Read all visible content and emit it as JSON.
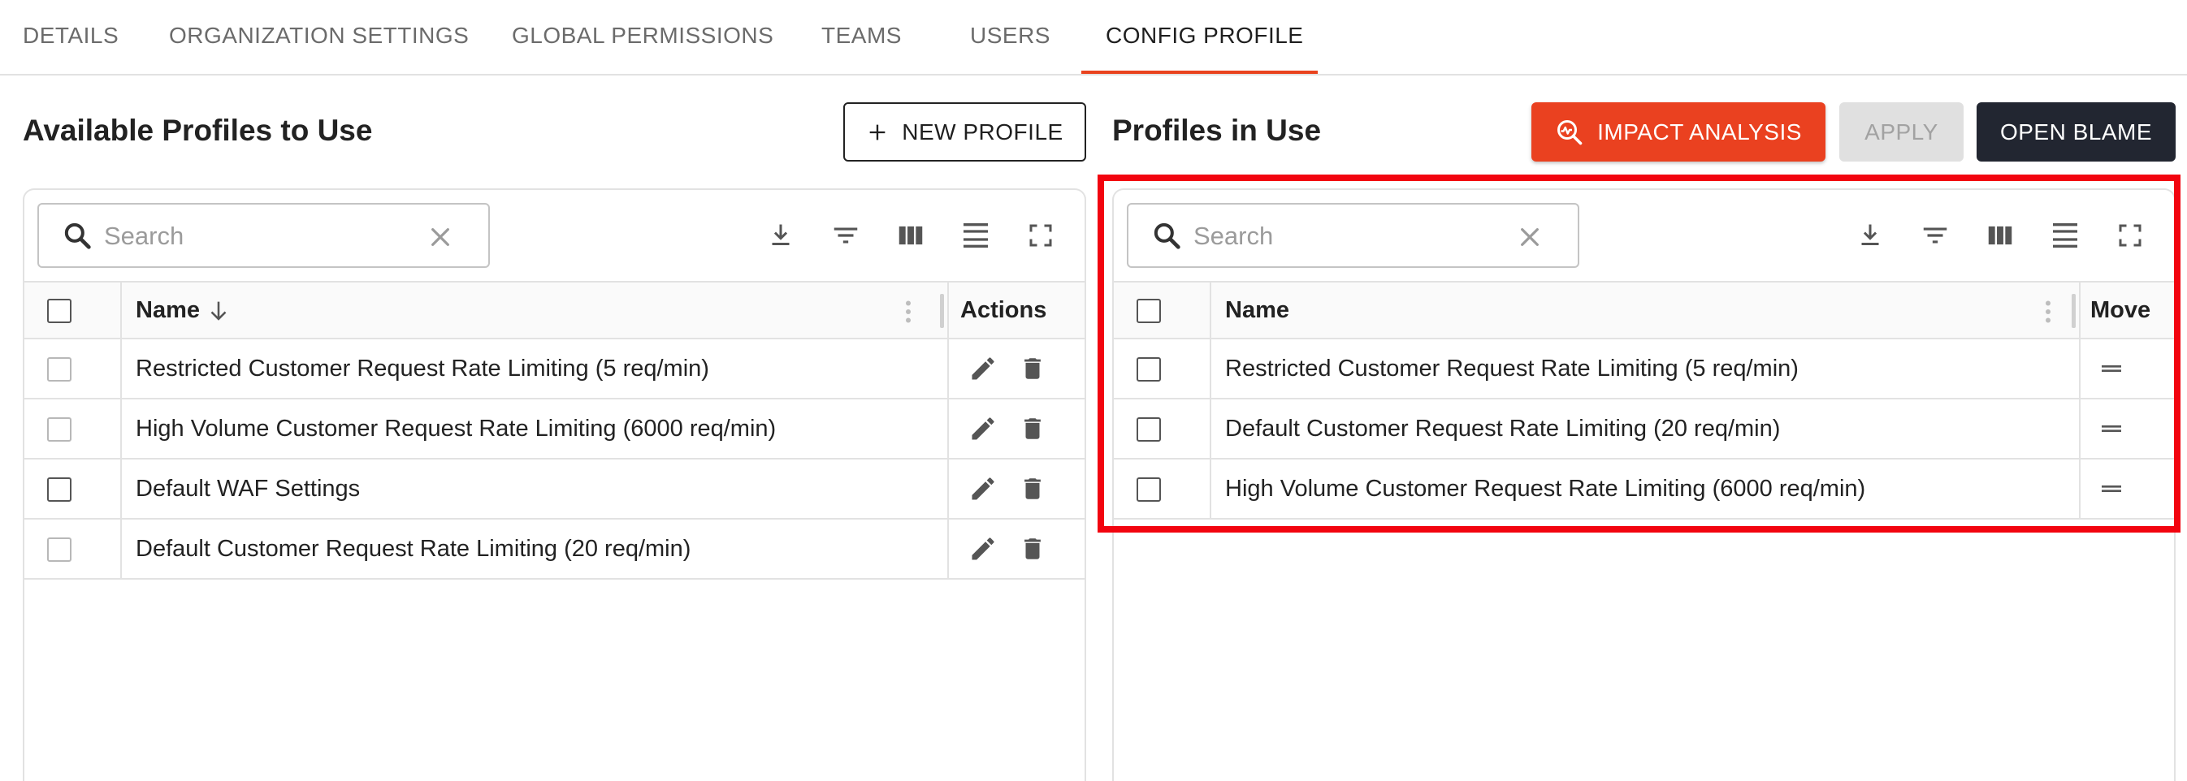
{
  "tabs": [
    {
      "label": "DETAILS"
    },
    {
      "label": "ORGANIZATION SETTINGS"
    },
    {
      "label": "GLOBAL PERMISSIONS"
    },
    {
      "label": "TEAMS"
    },
    {
      "label": "USERS"
    },
    {
      "label": "CONFIG PROFILE"
    }
  ],
  "active_tab": "CONFIG PROFILE",
  "left": {
    "title": "Available Profiles to Use",
    "new_profile_label": "NEW PROFILE",
    "search_placeholder": "Search",
    "columns": {
      "name": "Name",
      "actions": "Actions"
    },
    "rows": [
      {
        "name": "Restricted Customer Request Rate Limiting (5 req/min)"
      },
      {
        "name": "High Volume Customer Request Rate Limiting (6000 req/min)"
      },
      {
        "name": "Default WAF Settings"
      },
      {
        "name": "Default Customer Request Rate Limiting (20 req/min)"
      }
    ]
  },
  "right": {
    "title": "Profiles in Use",
    "impact_label": "IMPACT ANALYSIS",
    "apply_label": "APPLY",
    "blame_label": "OPEN BLAME",
    "search_placeholder": "Search",
    "columns": {
      "name": "Name",
      "move": "Move"
    },
    "rows": [
      {
        "name": "Restricted Customer Request Rate Limiting (5 req/min)"
      },
      {
        "name": "Default Customer Request Rate Limiting (20 req/min)"
      },
      {
        "name": "High Volume Customer Request Rate Limiting (6000 req/min)"
      }
    ]
  },
  "colors": {
    "accent": "#e9431e",
    "impact_button": "#ea4120",
    "dark_button": "#222631",
    "highlight": "#f2040f"
  },
  "icons": [
    "search-icon",
    "clear-icon",
    "download-icon",
    "filter-icon",
    "columns-icon",
    "density-icon",
    "fullscreen-icon",
    "edit-icon",
    "delete-icon",
    "drag-handle-icon",
    "plus-icon",
    "impact-analysis-icon",
    "sort-arrow-down-icon"
  ]
}
